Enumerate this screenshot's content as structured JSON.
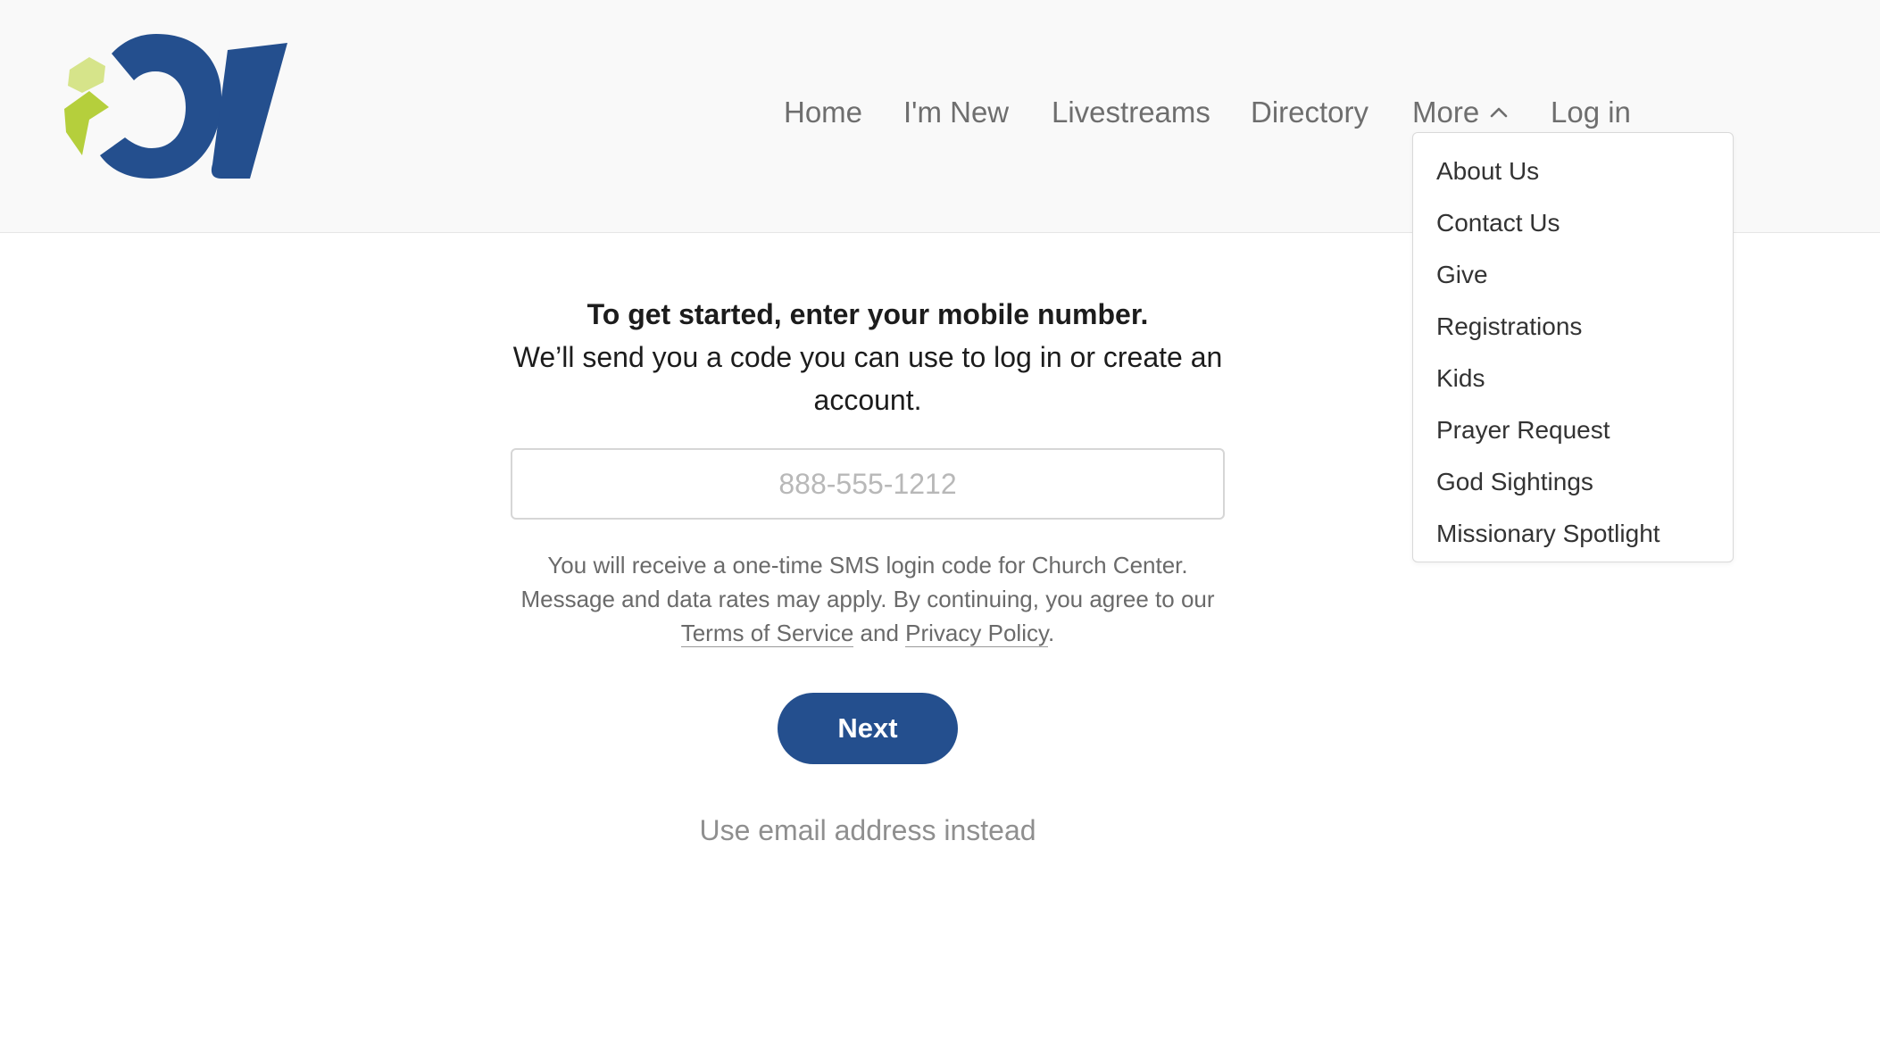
{
  "nav": {
    "items": [
      "Home",
      "I'm New",
      "Livestreams",
      "Directory"
    ],
    "more_label": "More",
    "login_label": "Log in"
  },
  "dropdown": {
    "items": [
      "About Us",
      "Contact Us",
      "Give",
      "Registrations",
      "Kids",
      "Prayer Request",
      "God Sightings",
      "Missionary Spotlight"
    ]
  },
  "login": {
    "heading_bold": "To get started, enter your mobile number.",
    "heading_rest": "We’ll send you a code you can use to log in or create an account.",
    "phone_placeholder": "888-555-1212",
    "disclaimer_pre": "You will receive a one-time SMS login code for Church Center. Message and data rates may apply. By continuing, you agree to our ",
    "terms_label": "Terms of Service",
    "and_text": " and ",
    "privacy_label": "Privacy Policy",
    "period": ".",
    "next_label": "Next",
    "email_link": "Use email address instead"
  },
  "colors": {
    "brand_blue": "#244f8e",
    "brand_green": "#b5cf3c",
    "brand_light_green": "#d6e48a"
  },
  "icons": {
    "more": "chevron-up-icon"
  }
}
